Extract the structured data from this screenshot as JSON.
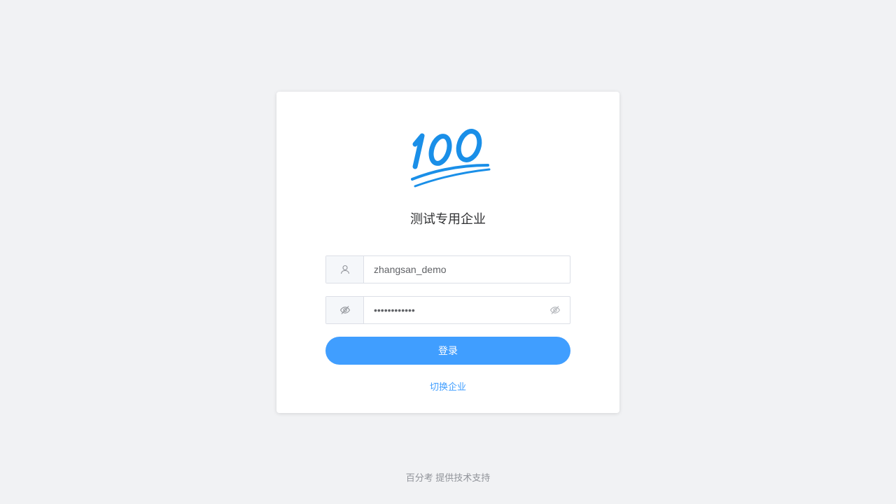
{
  "logo": {
    "icon": "hundred-points-icon",
    "text": "100",
    "color": "#1a8fe8"
  },
  "company": {
    "name": "测试专用企业"
  },
  "username": {
    "value": "zhangsan_demo",
    "icon": "user-icon"
  },
  "password": {
    "value": "password1234",
    "icon": "eye-slash-icon",
    "toggle_icon": "eye-slash-icon"
  },
  "actions": {
    "login_label": "登录",
    "switch_label": "切换企业"
  },
  "footer": {
    "text": "百分考 提供技术支持"
  },
  "colors": {
    "accent": "#409eff",
    "background": "#f1f2f4"
  }
}
